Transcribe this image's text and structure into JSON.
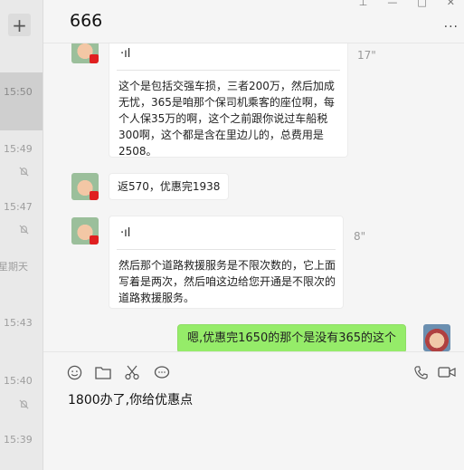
{
  "sidebar": {
    "plus_label": "+",
    "times": [
      "15:50",
      "15:49",
      "15:47",
      "星期天",
      "15:43",
      "15:40",
      "15:39"
    ]
  },
  "chat": {
    "title": "666",
    "messages": [
      {
        "type": "voice",
        "from": "other",
        "voice_symbol": "·ıl",
        "duration": "17\"",
        "transcript": "这个是包括交强车损，三者200万，然后加成无忧，365是咱那个保司机乘客的座位啊，每个人保35万的啊，这个之前跟你说过车船税300啊，这个都是含在里边儿的，总费用是2508。"
      },
      {
        "type": "text",
        "from": "other",
        "text": "返570，优惠完1938"
      },
      {
        "type": "voice",
        "from": "other",
        "voice_symbol": "·ıl",
        "duration": "8\"",
        "transcript": "然后那个道路救援服务是不限次数的，它上面写着是两次，然后咱这边给您开通是不限次的道路救援服务。"
      },
      {
        "type": "text",
        "from": "self",
        "text": "嗯,优惠完1650的那个是没有365的这个"
      }
    ]
  },
  "input": {
    "value": "1800办了,你给优惠点"
  },
  "colors": {
    "self_bubble": "#95ec69",
    "other_bubble": "#ffffff",
    "background": "#f5f5f5"
  }
}
